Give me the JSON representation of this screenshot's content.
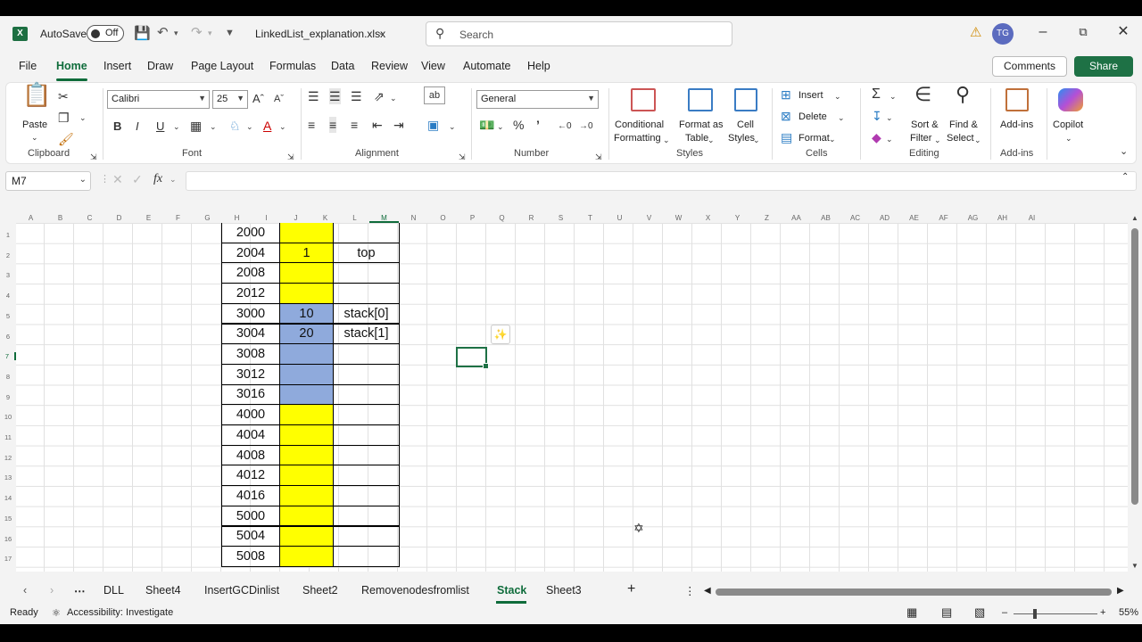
{
  "title_bar": {
    "autosave_label": "AutoSave",
    "autosave_state": "Off",
    "filename": "LinkedList_explanation.xlsx",
    "search_placeholder": "Search",
    "user_initials": "TG"
  },
  "menu": [
    "File",
    "Home",
    "Insert",
    "Draw",
    "Page Layout",
    "Formulas",
    "Data",
    "Review",
    "View",
    "Automate",
    "Help"
  ],
  "menu_active": "Home",
  "comments_label": "Comments",
  "share_label": "Share",
  "ribbon": {
    "clipboard": {
      "paste": "Paste",
      "label": "Clipboard"
    },
    "font": {
      "name": "Calibri",
      "size": "25",
      "bold": "B",
      "italic": "I",
      "underline": "U",
      "label": "Font"
    },
    "alignment": {
      "label": "Alignment"
    },
    "number": {
      "format": "General",
      "label": "Number"
    },
    "styles": {
      "conditional": "Conditional",
      "conditional2": "Formatting",
      "format_table": "Format as",
      "format_table2": "Table",
      "cell_styles": "Cell",
      "cell_styles2": "Styles",
      "label": "Styles"
    },
    "cells": {
      "insert": "Insert",
      "delete": "Delete",
      "format": "Format",
      "label": "Cells"
    },
    "editing": {
      "sort": "Sort &",
      "sort2": "Filter",
      "find": "Find &",
      "find2": "Select",
      "label": "Editing"
    },
    "addins": {
      "addins": "Add-ins",
      "label": "Add-ins"
    },
    "copilot": {
      "label": "Copilot"
    }
  },
  "name_box": "M7",
  "fx": "fx",
  "columns": [
    "A",
    "B",
    "C",
    "D",
    "E",
    "F",
    "G",
    "H",
    "I",
    "J",
    "K",
    "L",
    "M",
    "N",
    "O",
    "P",
    "Q",
    "R",
    "S",
    "T",
    "U",
    "V",
    "W",
    "X",
    "Y",
    "Z",
    "AA",
    "AB",
    "AC",
    "AD",
    "AE",
    "AF",
    "AG",
    "AH",
    "AI"
  ],
  "rows": [
    "1",
    "2",
    "3",
    "4",
    "5",
    "6",
    "7",
    "8",
    "9",
    "10",
    "11",
    "12",
    "13",
    "14",
    "15",
    "16",
    "17"
  ],
  "table": [
    {
      "addr": "2000",
      "val": "",
      "note": "",
      "color": "yellow"
    },
    {
      "addr": "2004",
      "val": "1",
      "note": "top",
      "color": "yellow"
    },
    {
      "addr": "2008",
      "val": "",
      "note": "",
      "color": "yellow"
    },
    {
      "addr": "2012",
      "val": "",
      "note": "",
      "color": "yellow"
    },
    {
      "addr": "3000",
      "val": "10",
      "note": "stack[0]",
      "color": "blue"
    },
    {
      "addr": "3004",
      "val": "20",
      "note": "stack[1]",
      "color": "blue"
    },
    {
      "addr": "3008",
      "val": "",
      "note": "",
      "color": "blue"
    },
    {
      "addr": "3012",
      "val": "",
      "note": "",
      "color": "blue"
    },
    {
      "addr": "3016",
      "val": "",
      "note": "",
      "color": "blue"
    },
    {
      "addr": "4000",
      "val": "",
      "note": "",
      "color": "yellow"
    },
    {
      "addr": "4004",
      "val": "",
      "note": "",
      "color": "yellow"
    },
    {
      "addr": "4008",
      "val": "",
      "note": "",
      "color": "yellow"
    },
    {
      "addr": "4012",
      "val": "",
      "note": "",
      "color": "yellow"
    },
    {
      "addr": "4016",
      "val": "",
      "note": "",
      "color": "yellow"
    },
    {
      "addr": "5000",
      "val": "",
      "note": "",
      "color": "yellow"
    },
    {
      "addr": "5004",
      "val": "",
      "note": "",
      "color": "yellow"
    },
    {
      "addr": "5008",
      "val": "",
      "note": "",
      "color": "yellow"
    }
  ],
  "sheet_tabs": [
    "DLL",
    "Sheet4",
    "InsertGCDinlist",
    "Sheet2",
    "Removenodesfromlist",
    "Stack",
    "Sheet3"
  ],
  "sheet_active": "Stack",
  "status": {
    "ready": "Ready",
    "accessibility": "Accessibility: Investigate",
    "zoom": "55%"
  },
  "colors": {
    "accent": "#0f6c3b",
    "yellow": "#ffff00",
    "blue": "#8faadc"
  }
}
